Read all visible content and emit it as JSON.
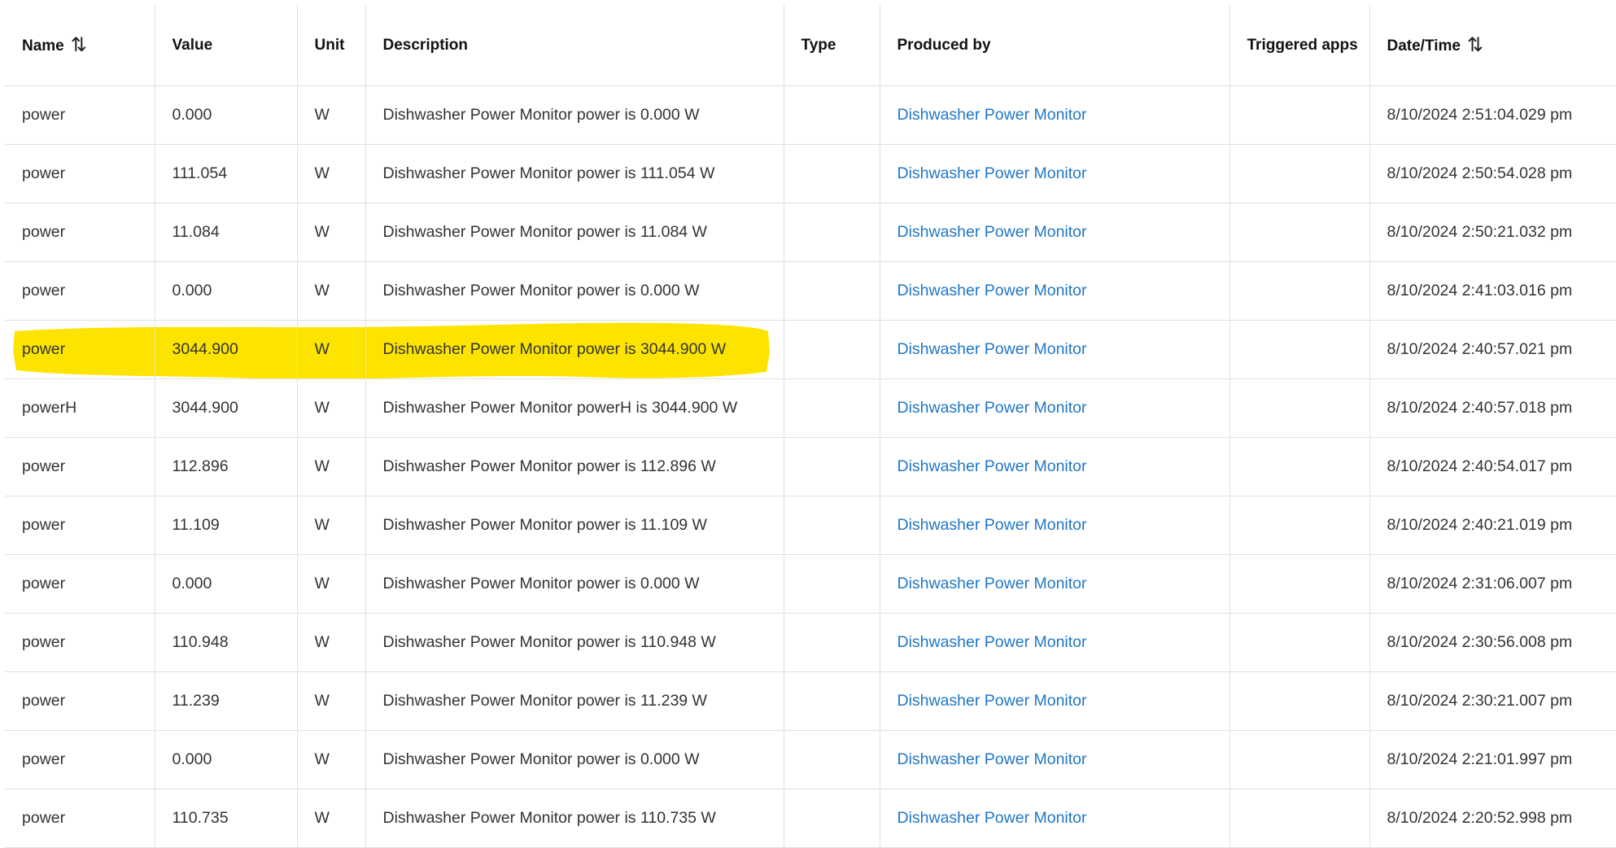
{
  "headers": {
    "name": "Name",
    "value": "Value",
    "unit": "Unit",
    "description": "Description",
    "type": "Type",
    "produced_by": "Produced by",
    "triggered_apps": "Triggered apps",
    "datetime": "Date/Time",
    "sort_icon": "⇅"
  },
  "highlight_color": "#fde400",
  "link_color": "#1f77c6",
  "rows": [
    {
      "name": "power",
      "value": "0.000",
      "unit": "W",
      "description": "Dishwasher Power Monitor power is 0.000 W",
      "type": "",
      "produced_by": "Dishwasher Power Monitor",
      "triggered_apps": "",
      "datetime": "8/10/2024 2:51:04.029 pm"
    },
    {
      "name": "power",
      "value": "111.054",
      "unit": "W",
      "description": "Dishwasher Power Monitor power is 111.054 W",
      "type": "",
      "produced_by": "Dishwasher Power Monitor",
      "triggered_apps": "",
      "datetime": "8/10/2024 2:50:54.028 pm"
    },
    {
      "name": "power",
      "value": "11.084",
      "unit": "W",
      "description": "Dishwasher Power Monitor power is 11.084 W",
      "type": "",
      "produced_by": "Dishwasher Power Monitor",
      "triggered_apps": "",
      "datetime": "8/10/2024 2:50:21.032 pm"
    },
    {
      "name": "power",
      "value": "0.000",
      "unit": "W",
      "description": "Dishwasher Power Monitor power is 0.000 W",
      "type": "",
      "produced_by": "Dishwasher Power Monitor",
      "triggered_apps": "",
      "datetime": "8/10/2024 2:41:03.016 pm"
    },
    {
      "name": "power",
      "value": "3044.900",
      "unit": "W",
      "description": "Dishwasher Power Monitor power is 3044.900 W",
      "type": "",
      "produced_by": "Dishwasher Power Monitor",
      "triggered_apps": "",
      "datetime": "8/10/2024 2:40:57.021 pm",
      "highlighted": true
    },
    {
      "name": "powerH",
      "value": "3044.900",
      "unit": "W",
      "description": "Dishwasher Power Monitor powerH is 3044.900 W",
      "type": "",
      "produced_by": "Dishwasher Power Monitor",
      "triggered_apps": "",
      "datetime": "8/10/2024 2:40:57.018 pm"
    },
    {
      "name": "power",
      "value": "112.896",
      "unit": "W",
      "description": "Dishwasher Power Monitor power is 112.896 W",
      "type": "",
      "produced_by": "Dishwasher Power Monitor",
      "triggered_apps": "",
      "datetime": "8/10/2024 2:40:54.017 pm"
    },
    {
      "name": "power",
      "value": "11.109",
      "unit": "W",
      "description": "Dishwasher Power Monitor power is 11.109 W",
      "type": "",
      "produced_by": "Dishwasher Power Monitor",
      "triggered_apps": "",
      "datetime": "8/10/2024 2:40:21.019 pm"
    },
    {
      "name": "power",
      "value": "0.000",
      "unit": "W",
      "description": "Dishwasher Power Monitor power is 0.000 W",
      "type": "",
      "produced_by": "Dishwasher Power Monitor",
      "triggered_apps": "",
      "datetime": "8/10/2024 2:31:06.007 pm"
    },
    {
      "name": "power",
      "value": "110.948",
      "unit": "W",
      "description": "Dishwasher Power Monitor power is 110.948 W",
      "type": "",
      "produced_by": "Dishwasher Power Monitor",
      "triggered_apps": "",
      "datetime": "8/10/2024 2:30:56.008 pm"
    },
    {
      "name": "power",
      "value": "11.239",
      "unit": "W",
      "description": "Dishwasher Power Monitor power is 11.239 W",
      "type": "",
      "produced_by": "Dishwasher Power Monitor",
      "triggered_apps": "",
      "datetime": "8/10/2024 2:30:21.007 pm"
    },
    {
      "name": "power",
      "value": "0.000",
      "unit": "W",
      "description": "Dishwasher Power Monitor power is 0.000 W",
      "type": "",
      "produced_by": "Dishwasher Power Monitor",
      "triggered_apps": "",
      "datetime": "8/10/2024 2:21:01.997 pm"
    },
    {
      "name": "power",
      "value": "110.735",
      "unit": "W",
      "description": "Dishwasher Power Monitor power is 110.735 W",
      "type": "",
      "produced_by": "Dishwasher Power Monitor",
      "triggered_apps": "",
      "datetime": "8/10/2024 2:20:52.998 pm"
    }
  ]
}
